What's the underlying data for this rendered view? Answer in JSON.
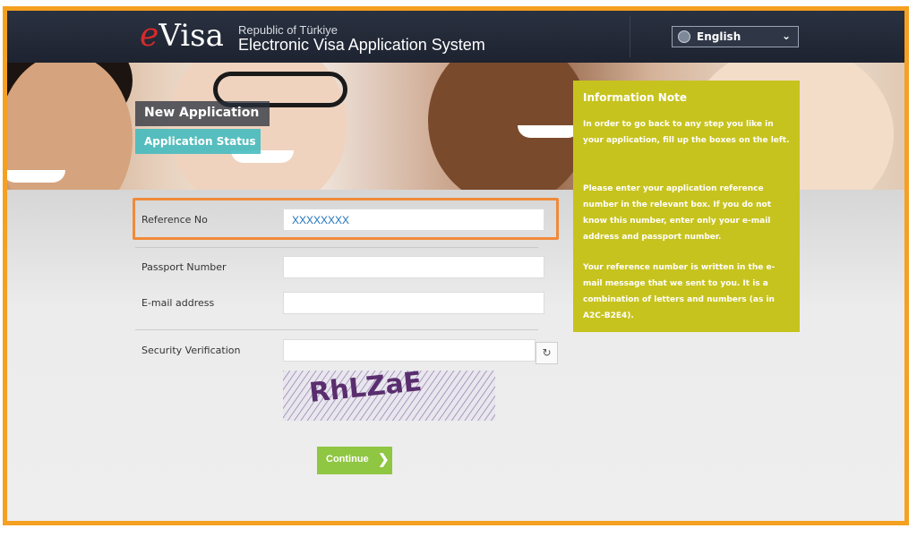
{
  "header": {
    "logo_e": "e",
    "logo_visa": "Visa",
    "subtitle": "Republic of Türkiye",
    "title": "Electronic Visa Application System",
    "language": "English"
  },
  "nav": {
    "new_application": "New Application",
    "application_status": "Application Status"
  },
  "form": {
    "reference_label": "Reference No",
    "reference_value": "XXXXXXXX",
    "passport_label": "Passport Number",
    "passport_value": "",
    "email_label": "E-mail address",
    "email_value": "",
    "security_label": "Security Verification",
    "security_value": "",
    "captcha_text": "RhLZaE",
    "continue_label": "Continue"
  },
  "info_note": {
    "title": "Information Note",
    "paragraph1": "In order to go back to any step you like in your application, fill up the boxes on the left.",
    "paragraph2": "Please enter your application reference number in the relevant box. If you do not know this number, enter only your e-mail address and passport number.",
    "paragraph3": "Your reference number is written in the e-mail message that we sent to you. It is a combination of letters and numbers (as in A2C-B2E4)."
  },
  "colors": {
    "frame": "#f5a021",
    "header": "#1d2330",
    "info_bg": "#c7c31e",
    "status_tab": "#3cbabe",
    "continue": "#8fc642",
    "highlight": "#f08a3a",
    "reference_text": "#1e73be"
  },
  "icons": {
    "language": "globe-icon",
    "dropdown": "chevron-down-icon",
    "refresh": "refresh-icon",
    "continue": "chevron-right-icon"
  }
}
